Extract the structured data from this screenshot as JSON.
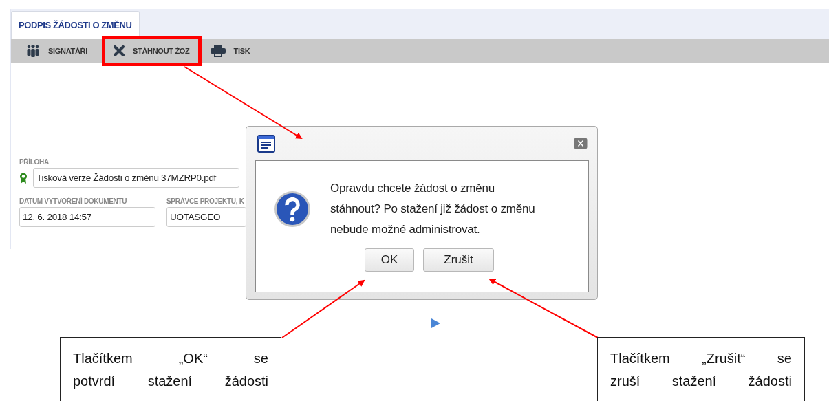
{
  "tab": {
    "label": "PODPIS ŽÁDOSTI O ZMĚNU",
    "selected": true
  },
  "toolbar": [
    {
      "label": "SIGNATÁŘI",
      "kind": "people",
      "highlighted": false
    },
    {
      "label": "STÁHNOUT ŽOZ",
      "kind": "cross",
      "highlighted": true
    },
    {
      "label": "TISK",
      "kind": "printer",
      "highlighted": false
    }
  ],
  "attachment": {
    "label": "PŘÍLOHA",
    "value": "Tisková verze Žádosti o změnu 37MZRP0.pdf"
  },
  "fields": [
    {
      "label": "DATUM VYTVOŘENÍ DOKUMENTU",
      "value": "12. 6. 2018 14:57"
    },
    {
      "label": "SPRÁVCE PROJEKTU, K",
      "value": "UOTASGEO"
    }
  ],
  "dialog": {
    "message": "Opravdu chcete žádost o změnu\nstáhnout? Po stažení již žádost o změnu\nnebude možné administrovat.",
    "buttons": [
      "OK",
      "Zrušit"
    ]
  },
  "callouts": [
    {
      "text": "Tlačítkem „OK“ se\npotvrdí stažení žádosti"
    },
    {
      "text": "Tlačítkem „Zrušit“ se\nzruší stažení žádosti"
    }
  ]
}
